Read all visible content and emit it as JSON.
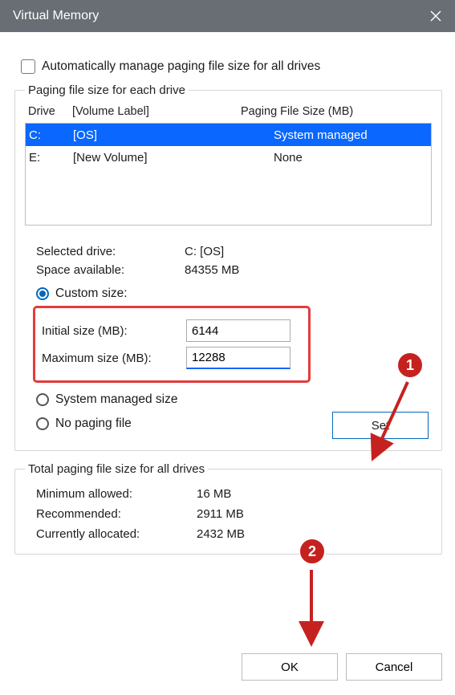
{
  "title": "Virtual Memory",
  "auto_label": "Automatically manage paging file size for all drives",
  "group1_legend": "Paging file size for each drive",
  "headers": {
    "drive": "Drive",
    "vol": "[Volume Label]",
    "pf": "Paging File Size (MB)"
  },
  "drives": [
    {
      "letter": "C:",
      "vol": "[OS]",
      "pf": "System managed"
    },
    {
      "letter": "E:",
      "vol": "[New Volume]",
      "pf": "None"
    }
  ],
  "selected_drive_lbl": "Selected drive:",
  "selected_drive_val": "C:  [OS]",
  "space_lbl": "Space available:",
  "space_val": "84355 MB",
  "custom_label": "Custom size:",
  "initial_lbl": "Initial size (MB):",
  "initial_val": "6144",
  "max_lbl": "Maximum size (MB):",
  "max_val": "12288",
  "sysman_label": "System managed size",
  "nopf_label": "No paging file",
  "set_label": "Set",
  "group2_legend": "Total paging file size for all drives",
  "min_lbl": "Minimum allowed:",
  "min_val": "16 MB",
  "rec_lbl": "Recommended:",
  "rec_val": "2911 MB",
  "cur_lbl": "Currently allocated:",
  "cur_val": "2432 MB",
  "ok_label": "OK",
  "cancel_label": "Cancel",
  "badge1": "1",
  "badge2": "2"
}
